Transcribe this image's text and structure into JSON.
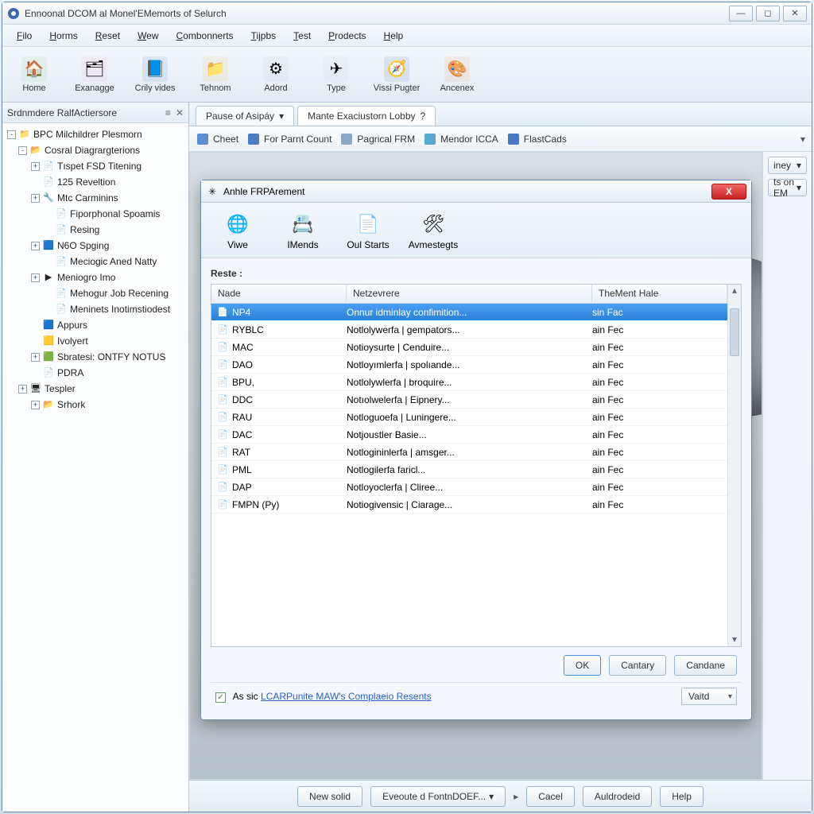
{
  "window": {
    "title": "Ennoonal DCOM al Monel'EMemorts of Selurch"
  },
  "menubar": [
    "Filo",
    "Horms",
    "Reset",
    "Wew",
    "Combonnerts",
    "Tijpbs",
    "Test",
    "Prodects",
    "Help"
  ],
  "toolbar": [
    {
      "label": "Home",
      "glyph": "🏠",
      "bg": "#8fd28f"
    },
    {
      "label": "Exanagge",
      "glyph": "🗂",
      "bg": "#f4b0c8"
    },
    {
      "label": "Crily vides",
      "glyph": "📘",
      "bg": "#5a8fd8"
    },
    {
      "label": "Tehnom",
      "glyph": "📁",
      "bg": "#f0c060"
    },
    {
      "label": "Adord",
      "glyph": "⚙",
      "bg": "#b8c4d0"
    },
    {
      "label": "Type",
      "glyph": "✈",
      "bg": "#c8d4e0"
    },
    {
      "label": "Vissi Pugter",
      "glyph": "🧭",
      "bg": "#5a78c0"
    },
    {
      "label": "Ancenex",
      "glyph": "🎨",
      "bg": "#f0a060"
    }
  ],
  "sidebar": {
    "title": "Srdnmdere RalfActiersore",
    "tree": [
      {
        "d": 0,
        "tog": "-",
        "ic": "📁",
        "txt": "BPC Milchildrer Plesmorn"
      },
      {
        "d": 1,
        "tog": "-",
        "ic": "📂",
        "txt": "Cosral Diagrargterions"
      },
      {
        "d": 2,
        "tog": "+",
        "ic": "📄",
        "txt": "Tıspet FSD Titening"
      },
      {
        "d": 2,
        "tog": "",
        "ic": "📄",
        "txt": "125 Reveltion"
      },
      {
        "d": 2,
        "tog": "+",
        "ic": "🔧",
        "txt": "Mtc Carminins"
      },
      {
        "d": 3,
        "tog": "",
        "ic": "📄",
        "txt": "Fiporphonal Spoamis"
      },
      {
        "d": 3,
        "tog": "",
        "ic": "📄",
        "txt": "Resing"
      },
      {
        "d": 2,
        "tog": "+",
        "ic": "🟦",
        "txt": "N6O Spging"
      },
      {
        "d": 3,
        "tog": "",
        "ic": "📄",
        "txt": "Meciogic Aned Natty"
      },
      {
        "d": 2,
        "tog": "+",
        "ic": "▶",
        "txt": "Meniogro Imo"
      },
      {
        "d": 3,
        "tog": "",
        "ic": "📄",
        "txt": "Mehogur Job Recening"
      },
      {
        "d": 3,
        "tog": "",
        "ic": "📄",
        "txt": "Meninets Inotimstiodest"
      },
      {
        "d": 2,
        "tog": "",
        "ic": "🟦",
        "txt": "Appurs"
      },
      {
        "d": 2,
        "tog": "",
        "ic": "🟨",
        "txt": "Ivolyert"
      },
      {
        "d": 2,
        "tog": "+",
        "ic": "🟩",
        "txt": "Sbratesi: ONTFY NOTUS"
      },
      {
        "d": 2,
        "tog": "",
        "ic": "📄",
        "txt": "PDRA"
      },
      {
        "d": 1,
        "tog": "+",
        "ic": "🖥",
        "txt": "Tespler"
      },
      {
        "d": 2,
        "tog": "+",
        "ic": "📂",
        "txt": "Srhork"
      }
    ]
  },
  "tabs": [
    {
      "label": "Pause of Asipáy",
      "drop": true
    },
    {
      "label": "Mante Exaciustorn Lobby",
      "active": true,
      "help": true
    }
  ],
  "subbar": [
    {
      "label": "Cheet",
      "ic": "📋",
      "bg": "#5a8fd8"
    },
    {
      "label": "For Parnt Count",
      "ic": "🧊",
      "bg": "#4a7fc8"
    },
    {
      "label": "Pagrical FRM",
      "ic": "🕒",
      "bg": "#8aa8c8"
    },
    {
      "label": "Mendor ICCA",
      "ic": "💧",
      "bg": "#58a8d0"
    },
    {
      "label": "FlastCads",
      "ic": "🟦",
      "bg": "#4878c8"
    }
  ],
  "rightctl": [
    {
      "label": "iney"
    },
    {
      "label": "ts on EM"
    }
  ],
  "bottombar": {
    "new": "New solid",
    "exec": "Eveoute d FontnDOEF...",
    "cancel": "Cacel",
    "addr": "Auldrodeid",
    "help": "Help"
  },
  "dialog": {
    "title": "Anhle FRPArement",
    "toolbar": [
      {
        "label": "Viwe",
        "glyph": "🌐"
      },
      {
        "label": "IMends",
        "glyph": "📇"
      },
      {
        "label": "Oul Starts",
        "glyph": "📄"
      },
      {
        "label": "Avmestegts",
        "glyph": "🛠"
      }
    ],
    "sectionLabel": "Reste :",
    "columns": [
      "Nade",
      "Netzevrere",
      "TheMent Hale"
    ],
    "rows": [
      {
        "c1": "NP4",
        "c2": "Onnur idminlay confimition...",
        "c3": "sin Fac",
        "sel": true
      },
      {
        "c1": "RYBLC",
        "c2": "Notlolywerfa | gempators...",
        "c3": "ain Fec"
      },
      {
        "c1": "MAC",
        "c2": "Notioysurte | Cenduire...",
        "c3": "ain Fec"
      },
      {
        "c1": "DAO",
        "c2": "Notloyımlerfa | spolıande...",
        "c3": "ain Fec"
      },
      {
        "c1": "BPU,",
        "c2": "Notlolywlerfa | broquire...",
        "c3": "ain Fec"
      },
      {
        "c1": "DDC",
        "c2": "Notıolwelerfa | Eipnery...",
        "c3": "ain Fec"
      },
      {
        "c1": "RAU",
        "c2": "Notloguoefa | Luningere...",
        "c3": "ain Fec"
      },
      {
        "c1": "DAC",
        "c2": "Notjoustler Basie...",
        "c3": "ain Fec"
      },
      {
        "c1": "RAT",
        "c2": "Notlogininlerfa | amsger...",
        "c3": "ain Fec"
      },
      {
        "c1": "PML",
        "c2": "Notlogilerfa faricl...",
        "c3": "ain Fec"
      },
      {
        "c1": "DAP",
        "c2": "Notloyoclerfa | Cliree...",
        "c3": "ain Fec"
      },
      {
        "c1": "FMPN (Py)",
        "c2": "Notiogivensic | Ciarage...",
        "c3": "ain Fec"
      }
    ],
    "buttons": {
      "ok": "OK",
      "cantary": "Cantary",
      "candane": "Candane"
    },
    "checkLabel": "As sic LCARPunite MAW's Complaeio Resents",
    "combo": "Vaitd"
  }
}
